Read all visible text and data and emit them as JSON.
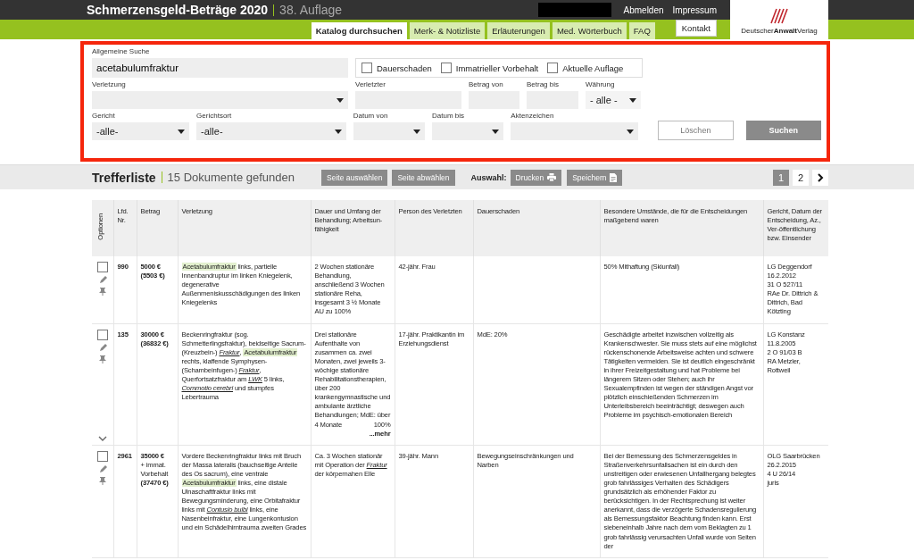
{
  "header": {
    "title": "Schmerzensgeld-Beträge 2020",
    "edition": "38. Auflage",
    "links": [
      "Abmelden",
      "Impressum"
    ]
  },
  "tabs": [
    {
      "label": "Katalog durchsuchen",
      "selected": true
    },
    {
      "label": "Merk- & Notizliste",
      "selected": false
    },
    {
      "label": "Erläuterungen",
      "selected": false
    },
    {
      "label": "Med. Wörterbuch",
      "selected": false
    },
    {
      "label": "FAQ",
      "selected": false
    }
  ],
  "contact": "Kontakt",
  "logo": "Deutscher**Anwalt**Verlag",
  "search": {
    "general": {
      "label": "Allgemeine Suche",
      "value": "acetabulumfraktur"
    },
    "checkboxes": [
      {
        "label": "Dauerschaden",
        "checked": false
      },
      {
        "label": "Immatrieller Vorbehalt",
        "checked": false
      },
      {
        "label": "Aktuelle Auflage",
        "checked": false
      }
    ],
    "row_2": [
      {
        "label": "Verletzung",
        "kind": "select"
      },
      {
        "label": "Verletzter",
        "kind": "text"
      },
      {
        "label": "Betrag von",
        "kind": "text"
      },
      {
        "label": "Betrag bis",
        "kind": "text"
      },
      {
        "label": "Währung",
        "kind": "select",
        "value": "- alle -"
      }
    ],
    "row_3": [
      {
        "label": "Gericht",
        "kind": "select",
        "value": "-alle-"
      },
      {
        "label": "Gerichtsort",
        "kind": "select",
        "value": "-alle-"
      },
      {
        "label": "Datum von",
        "kind": "select"
      },
      {
        "label": "Datum bis",
        "kind": "select"
      },
      {
        "label": "Aktenzeichen",
        "kind": "select"
      }
    ],
    "buttons": [
      {
        "label": "Löschen",
        "kind": "secondary"
      },
      {
        "label": "Suchen",
        "kind": "primary"
      }
    ]
  },
  "results": {
    "title": "Trefferliste",
    "count": "15 Dokumente gefunden",
    "page_buttons": [
      "Seite auswählen",
      "Seite abwählen"
    ],
    "selection_label": "Auswahl:",
    "actions": [
      {
        "label": "Drucken",
        "kind": "print"
      },
      {
        "label": "Speichern",
        "kind": "save"
      }
    ],
    "pages": [
      {
        "label": "1",
        "selected": true
      },
      {
        "label": "2",
        "selected": false
      }
    ]
  },
  "table": {
    "columns": [
      "Optionen",
      "Lfd. Nr.",
      "Betrag",
      "Verletzung",
      "Dauer und Umfang der Behandlung; Arbeitsun-fähigkeit",
      "Person des Verletzten",
      "Dauerschaden",
      "Besondere Umstände, die für die Entscheidungen maßgebend waren",
      "Gericht, Datum der Entscheidung, Az., Ver-öffentlichung bzw. Einsender"
    ],
    "rows": [
      {
        "checked": false,
        "collapsible": false,
        "nr": "990",
        "amount": "5000 €",
        "amount_adjusted": "(5503 €)",
        "injury": [
          {
            "kind": "highlight",
            "text": "Acetabulumfraktur"
          },
          {
            "kind": "plain",
            "text": " links, partielle Innenbandruptur im linken Kniegelenk, degenerative Außenmeniskusschädigungen des linken Kniegelenks"
          }
        ],
        "treatment": [
          {
            "kind": "plain",
            "text": "2 Wochen stationäre Behandlung, anschließend 3 Wochen stationäre Reha, insgesamt 3 ½ Monate AU zu 100%"
          }
        ],
        "person": "42-jähr. Frau",
        "circumstances": "50% Mithaftung (Skiunfall)",
        "court": "LG Deggendorf\n16.2.2012\n31 O 527/11\nRAe Dr. Dittrich & Dittrich, Bad Kötzting"
      },
      {
        "checked": false,
        "collapsible": true,
        "nr": "135",
        "amount": "30000 €",
        "amount_adjusted": "(36832 €)",
        "injury": [
          {
            "kind": "plain",
            "text": "Beckenringfraktur (sog. Schmetterlingsfraktur), beidseitige Sacrum- (Kreuzbein-) "
          },
          {
            "kind": "link",
            "text": "Fraktur"
          },
          {
            "kind": "plain",
            "text": ", "
          },
          {
            "kind": "highlight",
            "text": "Acetabulumfraktur"
          },
          {
            "kind": "plain",
            "text": " rechts, klaffende Symphysen- (Schambeinfugen-) "
          },
          {
            "kind": "link",
            "text": "Fraktur"
          },
          {
            "kind": "plain",
            "text": ", Querfortsatzfraktur am "
          },
          {
            "kind": "link",
            "text": "LWK"
          },
          {
            "kind": "plain",
            "text": " 5 links, "
          },
          {
            "kind": "link",
            "text": "Commotio cerebri"
          },
          {
            "kind": "plain",
            "text": " und stumpfes Lebertrauma"
          }
        ],
        "treatment": [
          {
            "kind": "plain",
            "text": "Drei stationäre Aufenthalte von zusammen ca. zwei Monaten, zwei jeweils 3-wöchige stationäre Rehabilitationstherapien, über 200 krankengymnastische und ambulante ärztliche Behandlungen; MdE: über"
          }
        ],
        "treatment_table": [
          "4 Monate",
          "100%"
        ],
        "more": "...mehr",
        "person": "17-jähr. Praktikantin im Erziehungsdienst",
        "damage": "MdE: 20%",
        "circumstances": "Geschädigte arbeitet inzwischen vollzeitig als Krankenschwester. Sie muss stets auf eine möglichst rückenschonende Arbeitsweise achten und schwere Tätigkeiten vermeiden. Sie ist deutlich eingeschränkt in ihrer Freizeitgestaltung und hat Probleme bei längerem Sitzen oder Stehen; auch ihr Sexualempfinden ist wegen der ständigen Angst vor plötzlich einschießenden Schmerzen im Unterleibsbereich beeinträchtigt; deswegen auch Probleme im psychisch-emotionalen Bereich",
        "court": "LG Konstanz\n11.8.2005\n2 O 91/03 B\nRA Metzler, Rottweil"
      },
      {
        "checked": false,
        "collapsible": false,
        "nr": "2961",
        "amount": "35000 €",
        "amount_note": "+ immat. Vorbehalt",
        "amount_adjusted": "(37470 €)",
        "injury": [
          {
            "kind": "plain",
            "text": "Vordere Beckenringfraktur links mit Bruch der Massa lateralis (bauchseitige Anteile des Os sacrum), eine ventrale "
          },
          {
            "kind": "highlight",
            "text": "Acetabulumfraktur"
          },
          {
            "kind": "plain",
            "text": " links, eine distale Ulnaschaftfraktur links mit Bewegungsminderung, eine Orbitafraktur links mit "
          },
          {
            "kind": "link",
            "text": "Contusio bulbi"
          },
          {
            "kind": "plain",
            "text": " links, eine Nasenbeinfraktur, eine Lungenkontusion und ein Schädelhirntrauma zweiten Grades"
          }
        ],
        "treatment": [
          {
            "kind": "plain",
            "text": "Ca. 3 Wochen stationär mit Operation der "
          },
          {
            "kind": "link",
            "text": "Fraktur"
          },
          {
            "kind": "plain",
            "text": " der körpernahen Elle"
          }
        ],
        "person": "39-jähr. Mann",
        "damage": "Bewegungseinschränkungen und Narben",
        "circumstances": "Bei der Bemessung des Schmerzensgeldes in Straßenverkehrsunfallsachen ist ein durch den unstreitigen oder erwiesenen Unfallhergang belegtes grob fahrlässiges Verhalten des Schädigers grundsätzlich als erhöhender Faktor zu berücksichtigen. In der Rechtsprechung ist weiter anerkannt, dass die verzögerte Schadensregulierung als Bemessungsfaktor Beachtung finden kann. Erst siebeneinhalb Jahre nach dem vom Beklagten zu 1 grob fahrlässig verursachten Unfall wurde von Seiten der",
        "court": "OLG Saarbrücken\n26.2.2015\n4 U 26/14\njuris"
      }
    ]
  }
}
